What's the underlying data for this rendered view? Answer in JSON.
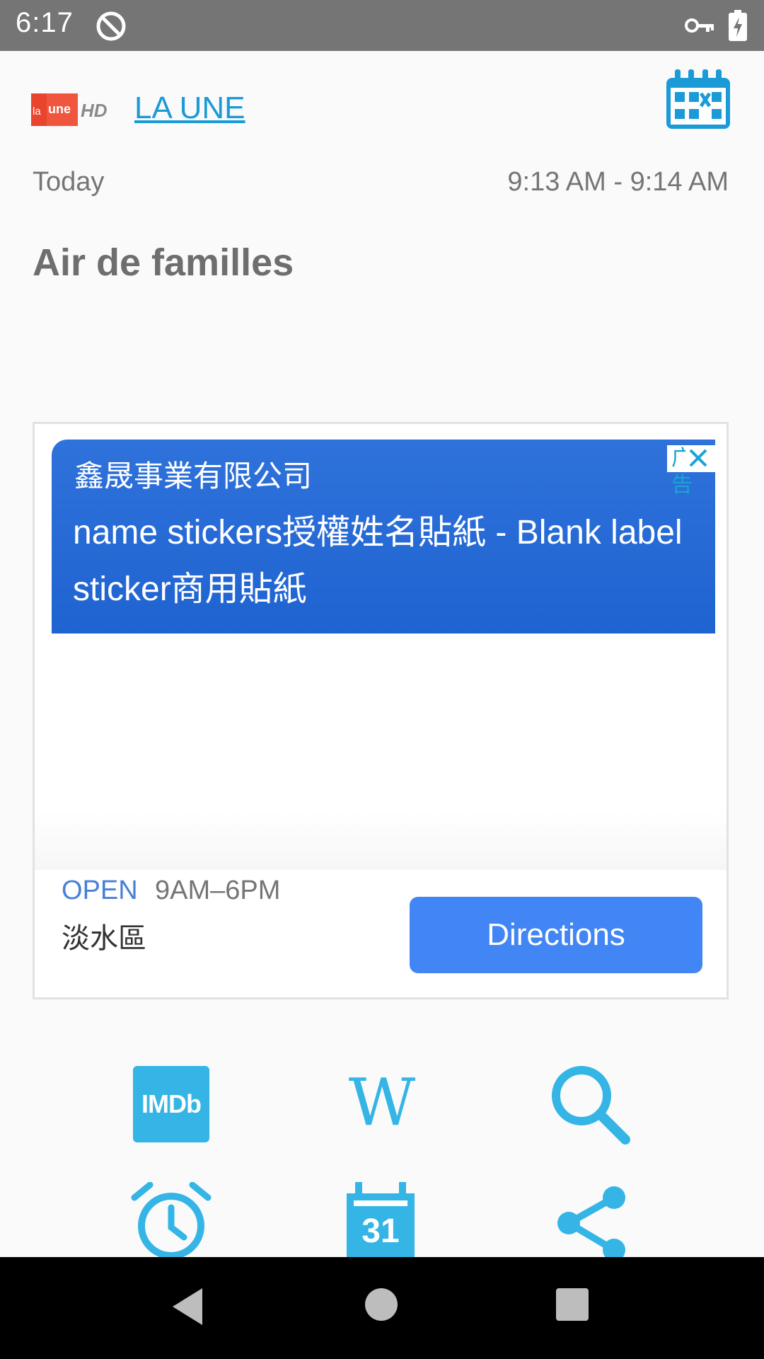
{
  "status_bar": {
    "time": "6:17"
  },
  "header": {
    "channel_logo_text": "la une HD",
    "channel_name": "LA UNE"
  },
  "program": {
    "date": "Today",
    "time_range": "9:13 AM - 9:14 AM",
    "title": "Air de familles"
  },
  "ad": {
    "label": "广告",
    "company": "鑫晟事業有限公司",
    "headline": "name stickers授權姓名貼紙 - Blank label sticker商用貼紙",
    "open_status": "OPEN",
    "hours": "9AM–6PM",
    "location": "淡水區",
    "directions_label": "Directions"
  },
  "actions": {
    "imdb_label": "IMDb",
    "wiki_label": "W",
    "calendar_day": "31"
  },
  "colors": {
    "accent": "#34b5e5",
    "ad_blue": "#2f72db",
    "directions_blue": "#4285f4"
  }
}
